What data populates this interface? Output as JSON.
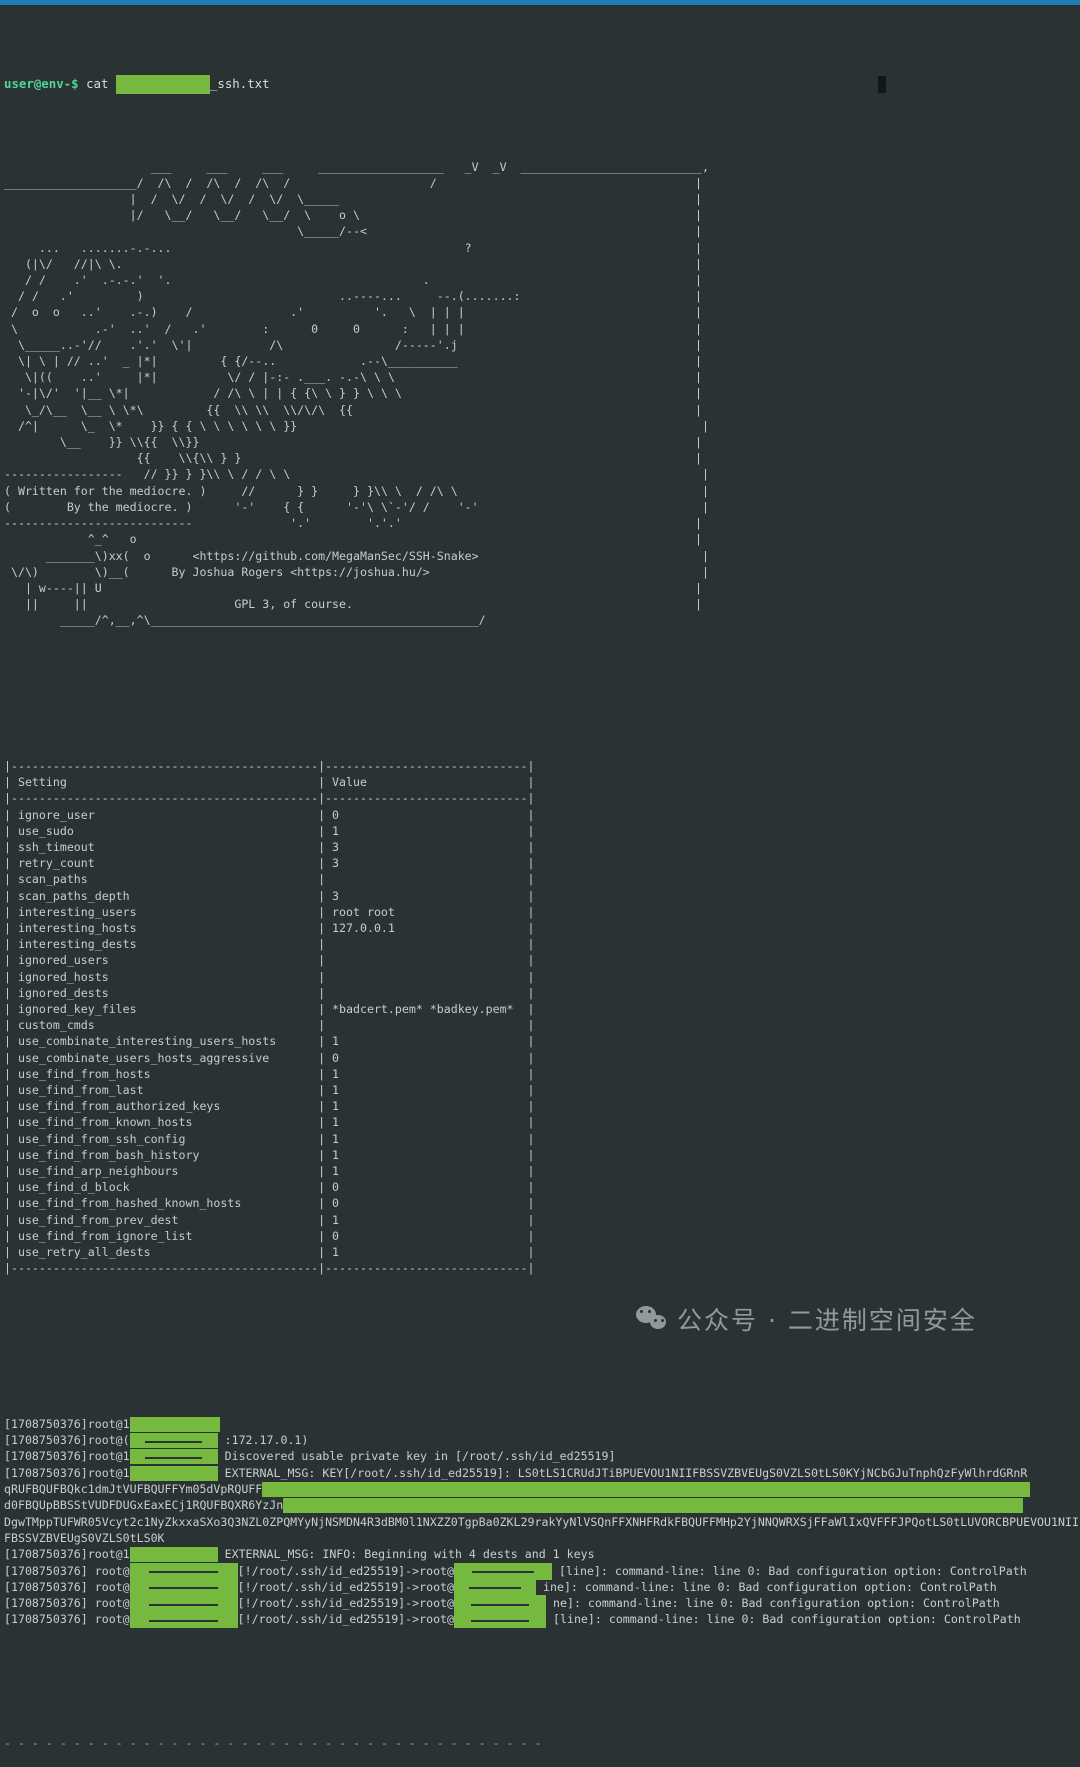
{
  "window": {
    "titlebar_color": "#1f7fb5",
    "background": "#2b3233",
    "foreground": "#c8cfd0",
    "redaction_color": "#76b93f"
  },
  "prompt": {
    "user_host": "user@env-$",
    "command_before": " cat ",
    "command_after": "_ssh.txt"
  },
  "banner": {
    "ascii_art": "                     ___     ___     ___     __________________   _V  _V  __________________________,\n___________________/  /\\  /  /\\  /  /\\  /                    /                                     |\n                  |  /  \\/  /  \\/  /  \\/  \\_____                                                   |\n                  |/   \\__/   \\__/   \\__/  \\    o \\                                                |\n                                          \\_____/--<                                               |\n     ...   .......-.-...                                          ?                                |\n   (|\\/   //|\\ \\.                                                                                  |\n   / /    .'  .-.-.'  '.                                    .                                      |\n  / /   .'         )                            ..----...     --.(.......:                         |\n /  o  o   ..'    .-.)    /              .'          '.   \\  | | |                                 |\n \\           .-'  ..'  /   .'        :      0     0      :   | | |                                 |\n  \\_____..-'//    .'.'  \\'|           /\\                /-----'.j                                  |\n  \\| \\ | // ..'  _ |*|         { {/--..            .--\\__________                                  |\n   \\|((    ..'     |*|          \\/ / |-:- .___. -.-\\ \\ \\                                           |\n  '-|\\/'  '|__ \\*|            / /\\ \\ | | { {\\ \\ } } \\ \\ \\                                          |\n   \\_/\\__  \\__ \\ \\*\\         {{  \\\\ \\\\  \\\\/\\/\\  {{                                                 |\n  /^|      \\_  \\*    }} { { \\ \\ \\ \\ \\ \\ }}                                                          |\n        \\__    }} \\\\{{  \\\\}}                                                                       |\n                   {{    \\\\{\\\\ } }                                                                 |\n-----------------   // }} } }\\\\ \\ / / \\ \\                                                           |\n( Written for the mediocre. )     //      } }     } }\\\\ \\  / /\\ \\                                   |\n(        By the mediocre. )      '-'    { {      '-'\\ \\`-'/ /    '-'                                |\n---------------------------              '.'        '.'.'                                          |\n            ^_^   o                                                                                |\n      _______\\)xx(  o      <https://github.com/MegaManSec/SSH-Snake>                                |\n \\/\\)        \\)__(      By Joshua Rogers <https://joshua.hu/>                                       |\n   | w----|| U                                                                                     |\n   ||     ||                     GPL 3, of course.                                                 |\n        _____/^,__,^\\_______________________________________________/",
    "credits": {
      "written_for": "( Written for the mediocre. )",
      "by_the": "(        By the mediocre. )",
      "repo_url": "<https://github.com/MegaManSec/SSH-Snake>",
      "author": "By Joshua Rogers <https://joshua.hu/>",
      "license": "GPL 3, of course."
    }
  },
  "settings_table": {
    "headers": [
      "Setting",
      "Value"
    ],
    "rows": [
      [
        "ignore_user",
        "0"
      ],
      [
        "use_sudo",
        "1"
      ],
      [
        "ssh_timeout",
        "3"
      ],
      [
        "retry_count",
        "3"
      ],
      [
        "scan_paths",
        ""
      ],
      [
        "scan_paths_depth",
        "3"
      ],
      [
        "interesting_users",
        "root root"
      ],
      [
        "interesting_hosts",
        "127.0.0.1"
      ],
      [
        "interesting_dests",
        ""
      ],
      [
        "ignored_users",
        ""
      ],
      [
        "ignored_hosts",
        ""
      ],
      [
        "ignored_dests",
        ""
      ],
      [
        "ignored_key_files",
        "*badcert.pem* *badkey.pem*"
      ],
      [
        "custom_cmds",
        ""
      ],
      [
        "use_combinate_interesting_users_hosts",
        "1"
      ],
      [
        "use_combinate_users_hosts_aggressive",
        "0"
      ],
      [
        "use_find_from_hosts",
        "1"
      ],
      [
        "use_find_from_last",
        "1"
      ],
      [
        "use_find_from_authorized_keys",
        "1"
      ],
      [
        "use_find_from_known_hosts",
        "1"
      ],
      [
        "use_find_from_ssh_config",
        "1"
      ],
      [
        "use_find_from_bash_history",
        "1"
      ],
      [
        "use_find_arp_neighbours",
        "1"
      ],
      [
        "use_find_d_block",
        "0"
      ],
      [
        "use_find_from_hashed_known_hosts",
        "0"
      ],
      [
        "use_find_from_prev_dest",
        "1"
      ],
      [
        "use_find_from_ignore_list",
        "0"
      ],
      [
        "use_retry_all_dests",
        "1"
      ]
    ]
  },
  "log": {
    "timestamp": "[1708750376]",
    "entries": [
      {
        "id": "entry-1",
        "prefix": "[1708750376]root@1",
        "redacted": true,
        "message": ""
      },
      {
        "id": "entry-2",
        "prefix": "[1708750376]root@(",
        "redacted": true,
        "message": ":172.17.0.1)"
      },
      {
        "id": "entry-3",
        "prefix": "[1708750376]root@1",
        "redacted": true,
        "message": "Discovered usable private key in [/root/.ssh/id_ed25519]"
      },
      {
        "id": "entry-4",
        "prefix": "[1708750376]root@1",
        "redacted": true,
        "message": "EXTERNAL_MSG: KEY[/root/.ssh/id_ed25519]: LS0tLS1CRUdJTiBPUEVOU1NIIFBSSVZBVEUgS0VZLS0tLS0KYjNCbGJuTnphQzFyWlhrdGRnR"
      },
      {
        "id": "entry-5",
        "prefix": "[1708750376]root@1",
        "redacted": true,
        "message": "EXTERNAL_MSG: INFO: Beginning with 4 dests and 1 keys"
      }
    ],
    "key_blob_lines": [
      "qRUFBQUFBQkc1dmJtVUFBQUFFYm05dVpRQUFF",
      "d0FBQUpBBSStVUDFDUGxEaxECj1RQUFBQXR6YzJn",
      "DgwTMppTUFWR05Vcyt2c1NyZkxxaSXo3Q3NZL0ZPQMYyNjNSMDN4R3dBM0l1NXZZ0TgpBa0ZKL29rakYyNlVSQnFFXNHFRdkFBQUFFMHp2YjNNQWRXSjFFaWlIxQVFFFJPQotLS0tLUVORCBPUEVOU1NIIFBSSVZBVEUgS0VZLS0tLS0K"
    ],
    "dest_lines": [
      {
        "id": "dest-1",
        "prefix": "[1708750376] root@",
        "redacted_left": true,
        "path": "[!/root/.ssh/id_ed25519]->root@",
        "redacted_right": true,
        "suffix": "[line]: command-line: line 0: Bad configuration option: ControlPath"
      },
      {
        "id": "dest-2",
        "prefix": "[1708750376] root@",
        "redacted_left": true,
        "path": "[!/root/.ssh/id_ed25519]->root@",
        "redacted_right": true,
        "suffix": "ine]: command-line: line 0: Bad configuration option: ControlPath"
      },
      {
        "id": "dest-3",
        "prefix": "[1708750376] root@",
        "redacted_left": true,
        "path": "[!/root/.ssh/id_ed25519]->root@",
        "redacted_right": true,
        "suffix": "ne]: command-line: line 0: Bad configuration option: ControlPath"
      },
      {
        "id": "dest-4",
        "prefix": "[1708750376] root@",
        "redacted_left": true,
        "path": "[!/root/.ssh/id_ed25519]->root@",
        "redacted_right": true,
        "suffix": "[line]: command-line: line 0: Bad configuration option: ControlPath"
      }
    ],
    "tail_separator": "- - - - - - - - - - - - - - - - - - - - - - - - - - - - - - - - - - - - - - -"
  },
  "watermark": {
    "text": "公众号 · 二进制空间安全",
    "icon": "wechat-icon",
    "color": "#9aa3a2"
  }
}
